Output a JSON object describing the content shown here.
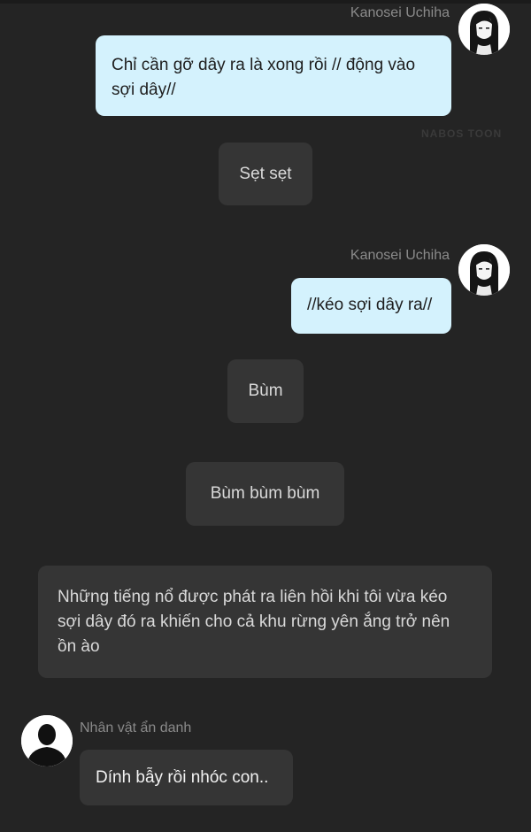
{
  "watermark": "NABOS TOON",
  "messages": [
    {
      "speaker": "Kanosei Uchiha",
      "text": "Chỉ cần gỡ dây ra là xong rồi // động vào sợi dây//"
    },
    {
      "text": "Sẹt sẹt"
    },
    {
      "speaker": "Kanosei Uchiha",
      "text": "//kéo sợi dây ra//"
    },
    {
      "text": "Bùm"
    },
    {
      "text": "Bùm bùm bùm"
    },
    {
      "text": "Những tiếng nổ được phát ra liên hồi khi tôi vừa kéo sợi dây đó ra khiến cho cả khu rừng yên ắng trở nên ồn ào"
    },
    {
      "speaker": "Nhân vật ẩn danh",
      "text": "Dính bẫy rồi nhóc con.."
    }
  ],
  "icons": {
    "user_avatar": "girl-portrait-icon",
    "npc_avatar": "silhouette-icon"
  },
  "colors": {
    "background": "#242424",
    "user_bubble": "#d4f2fd",
    "narration_bubble": "#353535"
  }
}
